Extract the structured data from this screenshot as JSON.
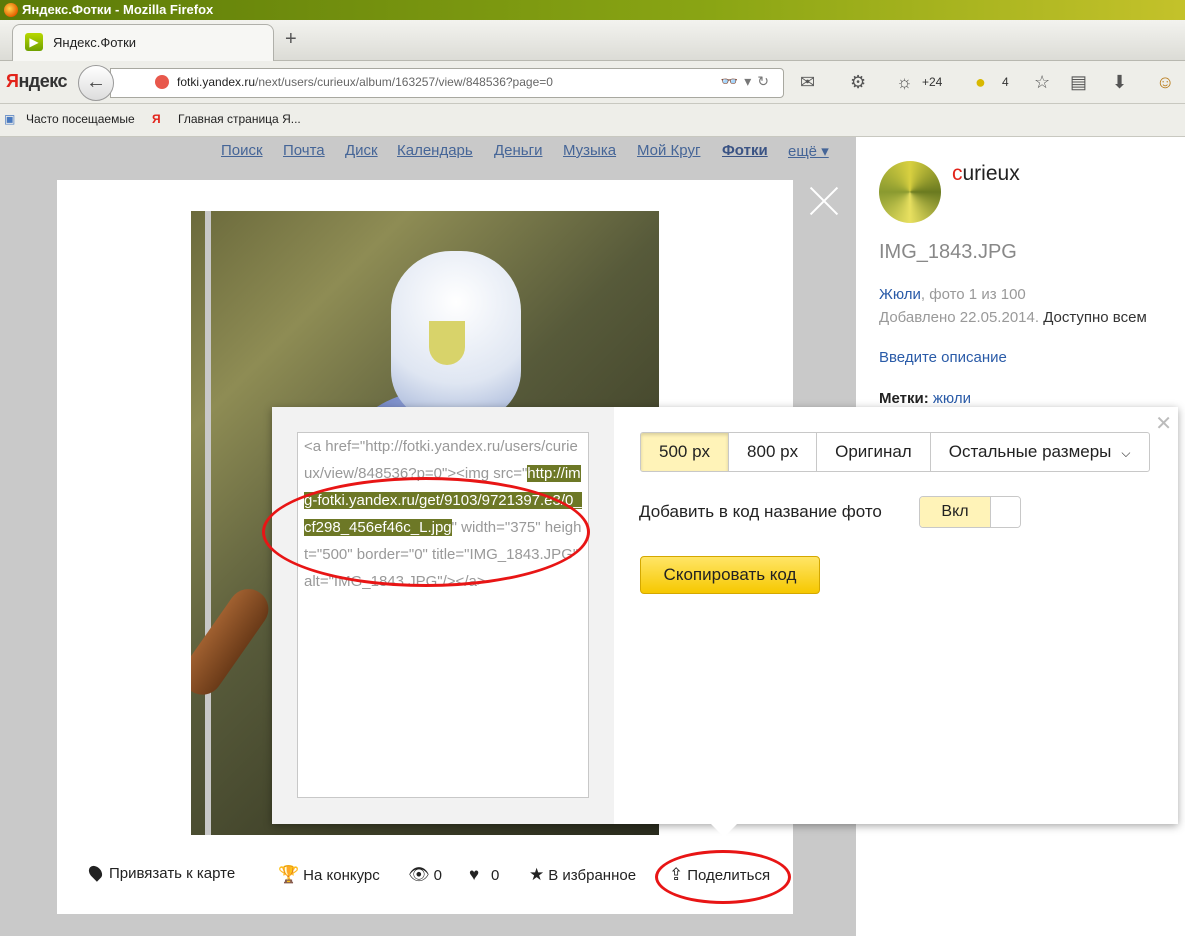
{
  "browser": {
    "window_title": "Яндекс.Фотки - Mozilla Firefox",
    "tab_label": "Яндекс.Фотки",
    "new_tab": "+",
    "logo_first": "Я",
    "logo_rest": "ндекс",
    "url_host": "fotki.yandex.ru",
    "url_path": "/next/users/curieux/album/163257/view/848536?page=0",
    "weather": "+24",
    "notif_count": "4",
    "bookmarks": [
      "Часто посещаемые",
      "Главная страница Я..."
    ]
  },
  "site_nav": [
    "Поиск",
    "Почта",
    "Диск",
    "Календарь",
    "Деньги",
    "Музыка",
    "Мой Круг",
    "Фотки",
    "ещё ▾"
  ],
  "info": {
    "author_first": "c",
    "author_rest": "urieux",
    "photo_name": "IMG_1843.JPG",
    "album_link": "Жюли",
    "photo_pos": ", фото 1 из 100",
    "added": "Добавлено 22.05.2014.",
    "access": "Доступно всем",
    "desc_link": "Введите описание",
    "tags_label": "Метки:",
    "tag": "жюли"
  },
  "toolbar": {
    "map": "Привязать к карте",
    "contest": "На конкурс",
    "views": "0",
    "likes": "0",
    "favorite": "В избранное",
    "share": "Поделиться"
  },
  "embed": {
    "code_pre": "<a href=\"http://fotki.yandex.ru/users/curieux/view/848536?p=0\"><img src=\"",
    "code_hl": "http://img-fotki.yandex.ru/get/9103/9721397.e3/0_cf298_456ef46c_L.jpg",
    "code_post": "\" width=\"375\" height=\"500\" border=\"0\" title=\"IMG_1843.JPG\" alt=\"IMG_1843.JPG\"/></a>",
    "sizes": [
      "500 px",
      "800 px",
      "Оригинал",
      "Остальные размеры"
    ],
    "add_name_label": "Добавить в код название фото",
    "toggle_label": "Вкл",
    "copy_button": "Скопировать код"
  }
}
